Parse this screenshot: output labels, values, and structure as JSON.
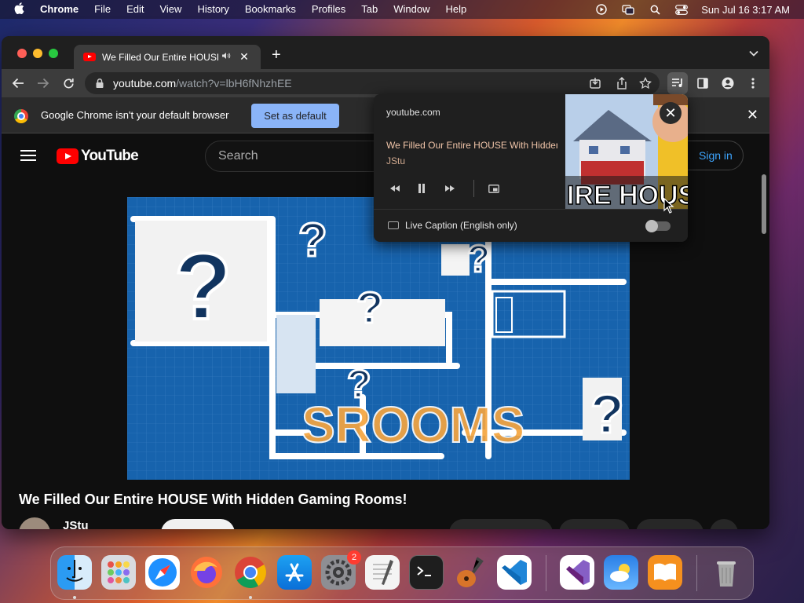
{
  "menubar": {
    "app_name": "Chrome",
    "menus": [
      "File",
      "Edit",
      "View",
      "History",
      "Bookmarks",
      "Profiles",
      "Tab",
      "Window",
      "Help"
    ],
    "clock": "Sun Jul 16  3:17 AM"
  },
  "tab": {
    "title": "We Filled Our Entire HOUSE With Hidden Gaming Rooms!",
    "audio_icon": "speaker-icon"
  },
  "toolbar": {
    "url_host": "youtube.com",
    "url_path": "/watch?v=lbH6fNhzhEE"
  },
  "infobar": {
    "message": "Google Chrome isn't your default browser",
    "button_label": "Set as default"
  },
  "youtube": {
    "logo_text": "YouTube",
    "search_placeholder": "Search",
    "signin_label": "Sign in",
    "video_title": "We Filled Our Entire HOUSE With Hidden Gaming Rooms!",
    "channel_name": "JStu",
    "video_overlay_text": "SROOMS"
  },
  "media_popup": {
    "site": "youtube.com",
    "title": "We Filled Our Entire HOUSE With Hidden Gaming Rooms!",
    "artist": "JStu",
    "thumb_text": "IRE HOUSE!",
    "live_caption_label": "Live Caption (English only)",
    "live_caption_enabled": false
  },
  "dock": {
    "apps": [
      "Finder",
      "Launchpad",
      "Safari",
      "Firefox",
      "Google Chrome",
      "App Store",
      "System Settings",
      "TextEdit",
      "Terminal",
      "GarageBand",
      "Visual Studio Code",
      "Visual Studio",
      "Weather",
      "Books",
      "Trash"
    ],
    "settings_badge": "2"
  },
  "colors": {
    "youtube_red": "#ff0000",
    "link_blue": "#3ea6ff",
    "set_default_button": "#8ab4f8"
  }
}
